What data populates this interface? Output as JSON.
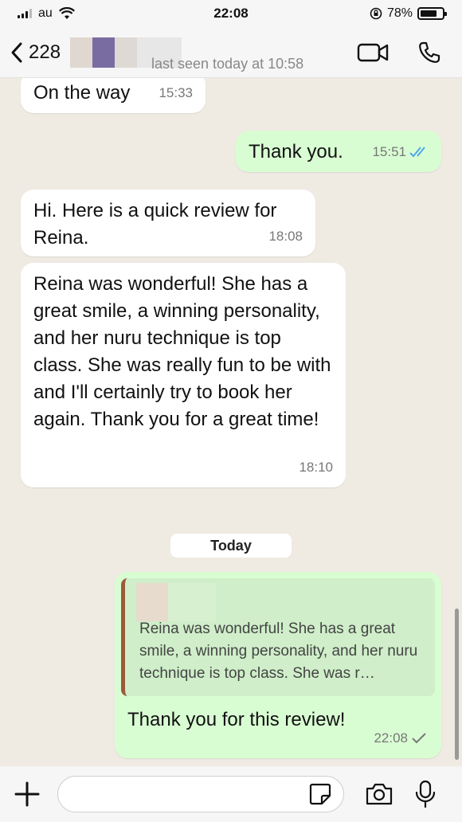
{
  "status_bar": {
    "carrier": "au",
    "time": "22:08",
    "battery": "78%",
    "battery_level": 0.78
  },
  "header": {
    "contact_prefix": "228",
    "last_seen": "last seen today at 10:58"
  },
  "messages": [
    {
      "dir": "in",
      "text": "On the way",
      "time": "15:33"
    },
    {
      "dir": "out",
      "text": "Thank you.",
      "time": "15:51",
      "read": true
    },
    {
      "dir": "in",
      "text": "Hi. Here is a quick review for Reina.",
      "time": "18:08"
    },
    {
      "dir": "in",
      "text": "Reina was wonderful! She has a great smile, a winning personality, and her nuru technique is top class. She was really fun to be with and I'll certainly try to book her again. Thank you for a great time!",
      "time": "18:10"
    }
  ],
  "date_separator": "Today",
  "reply": {
    "quote": "Reina was wonderful! She has a great smile, a winning personality, and her nuru technique is top class. She was r…",
    "text": "Thank you for this review!",
    "time": "22:08"
  },
  "input": {
    "placeholder": ""
  },
  "colors": {
    "outgoing": "#d9fdd3",
    "incoming": "#ffffff",
    "read_tick": "#4fa6e8",
    "background": "#efeae2"
  }
}
